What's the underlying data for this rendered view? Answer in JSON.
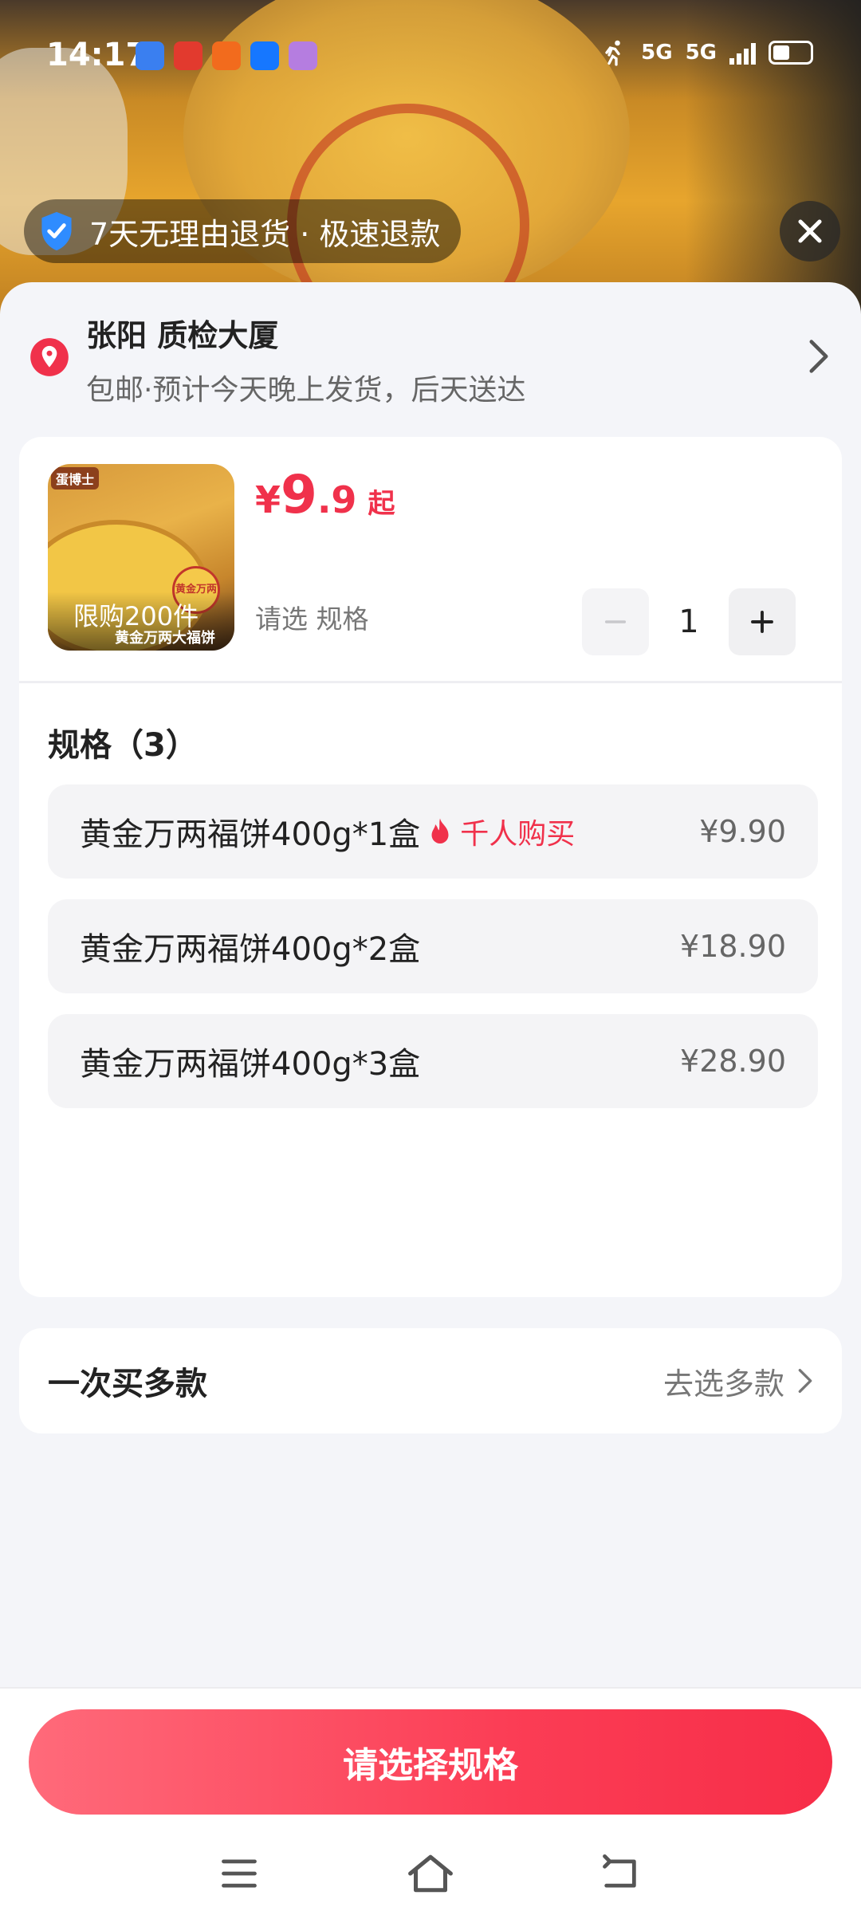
{
  "status_bar": {
    "time": "14:17",
    "network_1": "5G",
    "network_2": "5G",
    "app_icons": [
      {
        "name": "app-icon-blue",
        "color": "#3a7ff0"
      },
      {
        "name": "app-icon-red",
        "color": "#e23a2e"
      },
      {
        "name": "app-icon-orange",
        "color": "#f26b1d"
      },
      {
        "name": "alipay-icon",
        "color": "#1677ff"
      },
      {
        "name": "app-icon-purple",
        "color": "#b57de0"
      }
    ]
  },
  "overlay": {
    "guarantee_text": "7天无理由退货 · 极速退款"
  },
  "address": {
    "name": "张阳  质检大厦",
    "shipping": "包邮·预计今天晚上发货，后天送达"
  },
  "product": {
    "thumb_brand": "蛋博士",
    "thumb_seal": "黄金万两",
    "limit_text": "限购200件",
    "thumb_subtitle": "黄金万两大福饼",
    "price_currency": "¥",
    "price_int": "9",
    "price_dec": ".9",
    "price_suffix": "起",
    "select_hint": "请选 规格",
    "quantity": "1"
  },
  "specs": {
    "title": "规格（3）",
    "items": [
      {
        "name": "黄金万两福饼400g*1盒",
        "badge": "千人购买",
        "price": "¥9.90"
      },
      {
        "name": "黄金万两福饼400g*2盒",
        "badge": "",
        "price": "¥18.90"
      },
      {
        "name": "黄金万两福饼400g*3盒",
        "badge": "",
        "price": "¥28.90"
      }
    ]
  },
  "multi_buy": {
    "label": "一次买多款",
    "action": "去选多款"
  },
  "cta": {
    "label": "请选择规格"
  },
  "colors": {
    "accent": "#f0314b",
    "cta_gradient_start": "#ff6a7a",
    "cta_gradient_end": "#f72d48"
  }
}
